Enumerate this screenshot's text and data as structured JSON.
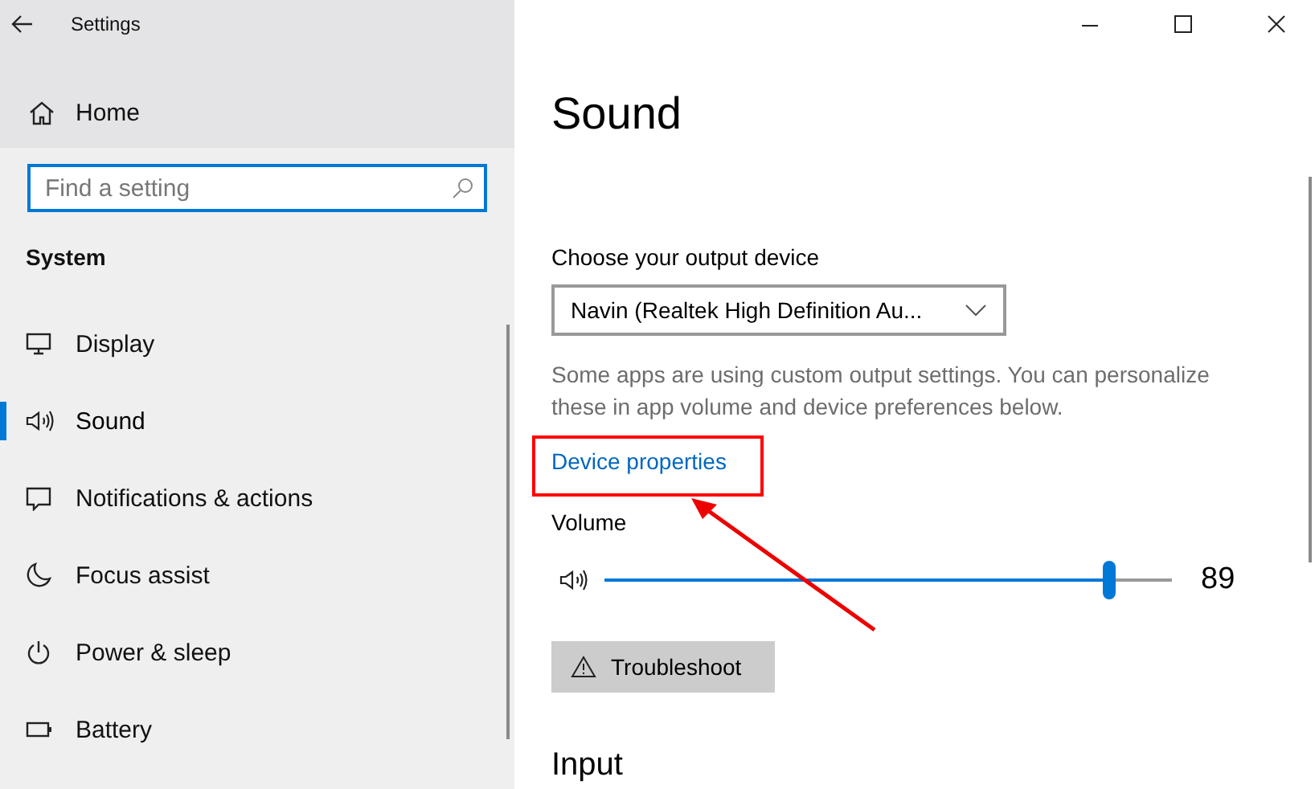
{
  "window": {
    "title": "Settings"
  },
  "sidebar": {
    "home": "Home",
    "search": {
      "placeholder": "Find a setting"
    },
    "section": "System",
    "items": [
      {
        "label": "Display",
        "kind": "display",
        "selected": false
      },
      {
        "label": "Sound",
        "kind": "sound",
        "selected": true
      },
      {
        "label": "Notifications & actions",
        "kind": "notifications",
        "selected": false
      },
      {
        "label": "Focus assist",
        "kind": "focus",
        "selected": false
      },
      {
        "label": "Power & sleep",
        "kind": "power",
        "selected": false
      },
      {
        "label": "Battery",
        "kind": "battery",
        "selected": false
      }
    ]
  },
  "page": {
    "title": "Sound",
    "output_label": "Choose your output device",
    "output_device": "Navin (Realtek High Definition Au...",
    "note": "Some apps are using custom output settings. You can personalize these in app volume and device preferences below.",
    "link": {
      "label": "Device properties",
      "highlighted": true
    },
    "volume": {
      "label": "Volume",
      "level": 0.89,
      "reading": "89"
    },
    "troubleshoot": "Troubleshoot",
    "next_section": "Input"
  }
}
